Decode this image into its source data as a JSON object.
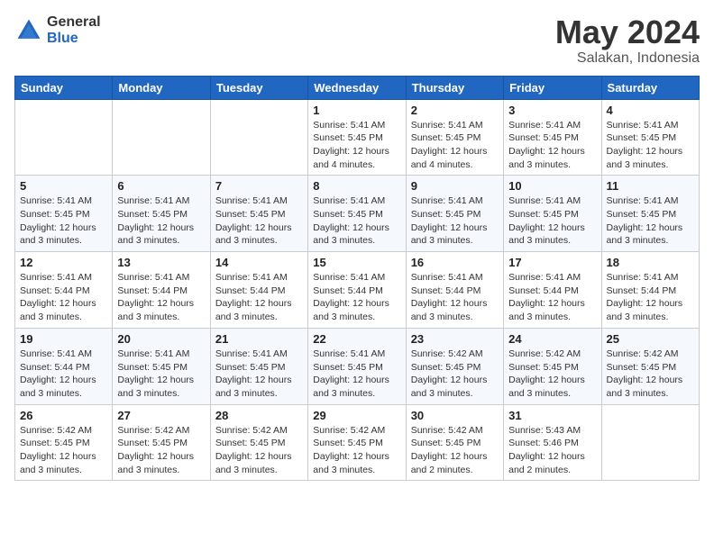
{
  "logo": {
    "general": "General",
    "blue": "Blue"
  },
  "title": {
    "month_year": "May 2024",
    "location": "Salakan, Indonesia"
  },
  "weekdays": [
    "Sunday",
    "Monday",
    "Tuesday",
    "Wednesday",
    "Thursday",
    "Friday",
    "Saturday"
  ],
  "weeks": [
    [
      {
        "day": "",
        "info": ""
      },
      {
        "day": "",
        "info": ""
      },
      {
        "day": "",
        "info": ""
      },
      {
        "day": "1",
        "info": "Sunrise: 5:41 AM\nSunset: 5:45 PM\nDaylight: 12 hours\nand 4 minutes."
      },
      {
        "day": "2",
        "info": "Sunrise: 5:41 AM\nSunset: 5:45 PM\nDaylight: 12 hours\nand 4 minutes."
      },
      {
        "day": "3",
        "info": "Sunrise: 5:41 AM\nSunset: 5:45 PM\nDaylight: 12 hours\nand 3 minutes."
      },
      {
        "day": "4",
        "info": "Sunrise: 5:41 AM\nSunset: 5:45 PM\nDaylight: 12 hours\nand 3 minutes."
      }
    ],
    [
      {
        "day": "5",
        "info": "Sunrise: 5:41 AM\nSunset: 5:45 PM\nDaylight: 12 hours\nand 3 minutes."
      },
      {
        "day": "6",
        "info": "Sunrise: 5:41 AM\nSunset: 5:45 PM\nDaylight: 12 hours\nand 3 minutes."
      },
      {
        "day": "7",
        "info": "Sunrise: 5:41 AM\nSunset: 5:45 PM\nDaylight: 12 hours\nand 3 minutes."
      },
      {
        "day": "8",
        "info": "Sunrise: 5:41 AM\nSunset: 5:45 PM\nDaylight: 12 hours\nand 3 minutes."
      },
      {
        "day": "9",
        "info": "Sunrise: 5:41 AM\nSunset: 5:45 PM\nDaylight: 12 hours\nand 3 minutes."
      },
      {
        "day": "10",
        "info": "Sunrise: 5:41 AM\nSunset: 5:45 PM\nDaylight: 12 hours\nand 3 minutes."
      },
      {
        "day": "11",
        "info": "Sunrise: 5:41 AM\nSunset: 5:45 PM\nDaylight: 12 hours\nand 3 minutes."
      }
    ],
    [
      {
        "day": "12",
        "info": "Sunrise: 5:41 AM\nSunset: 5:44 PM\nDaylight: 12 hours\nand 3 minutes."
      },
      {
        "day": "13",
        "info": "Sunrise: 5:41 AM\nSunset: 5:44 PM\nDaylight: 12 hours\nand 3 minutes."
      },
      {
        "day": "14",
        "info": "Sunrise: 5:41 AM\nSunset: 5:44 PM\nDaylight: 12 hours\nand 3 minutes."
      },
      {
        "day": "15",
        "info": "Sunrise: 5:41 AM\nSunset: 5:44 PM\nDaylight: 12 hours\nand 3 minutes."
      },
      {
        "day": "16",
        "info": "Sunrise: 5:41 AM\nSunset: 5:44 PM\nDaylight: 12 hours\nand 3 minutes."
      },
      {
        "day": "17",
        "info": "Sunrise: 5:41 AM\nSunset: 5:44 PM\nDaylight: 12 hours\nand 3 minutes."
      },
      {
        "day": "18",
        "info": "Sunrise: 5:41 AM\nSunset: 5:44 PM\nDaylight: 12 hours\nand 3 minutes."
      }
    ],
    [
      {
        "day": "19",
        "info": "Sunrise: 5:41 AM\nSunset: 5:44 PM\nDaylight: 12 hours\nand 3 minutes."
      },
      {
        "day": "20",
        "info": "Sunrise: 5:41 AM\nSunset: 5:45 PM\nDaylight: 12 hours\nand 3 minutes."
      },
      {
        "day": "21",
        "info": "Sunrise: 5:41 AM\nSunset: 5:45 PM\nDaylight: 12 hours\nand 3 minutes."
      },
      {
        "day": "22",
        "info": "Sunrise: 5:41 AM\nSunset: 5:45 PM\nDaylight: 12 hours\nand 3 minutes."
      },
      {
        "day": "23",
        "info": "Sunrise: 5:42 AM\nSunset: 5:45 PM\nDaylight: 12 hours\nand 3 minutes."
      },
      {
        "day": "24",
        "info": "Sunrise: 5:42 AM\nSunset: 5:45 PM\nDaylight: 12 hours\nand 3 minutes."
      },
      {
        "day": "25",
        "info": "Sunrise: 5:42 AM\nSunset: 5:45 PM\nDaylight: 12 hours\nand 3 minutes."
      }
    ],
    [
      {
        "day": "26",
        "info": "Sunrise: 5:42 AM\nSunset: 5:45 PM\nDaylight: 12 hours\nand 3 minutes."
      },
      {
        "day": "27",
        "info": "Sunrise: 5:42 AM\nSunset: 5:45 PM\nDaylight: 12 hours\nand 3 minutes."
      },
      {
        "day": "28",
        "info": "Sunrise: 5:42 AM\nSunset: 5:45 PM\nDaylight: 12 hours\nand 3 minutes."
      },
      {
        "day": "29",
        "info": "Sunrise: 5:42 AM\nSunset: 5:45 PM\nDaylight: 12 hours\nand 3 minutes."
      },
      {
        "day": "30",
        "info": "Sunrise: 5:42 AM\nSunset: 5:45 PM\nDaylight: 12 hours\nand 2 minutes."
      },
      {
        "day": "31",
        "info": "Sunrise: 5:43 AM\nSunset: 5:46 PM\nDaylight: 12 hours\nand 2 minutes."
      },
      {
        "day": "",
        "info": ""
      }
    ]
  ]
}
